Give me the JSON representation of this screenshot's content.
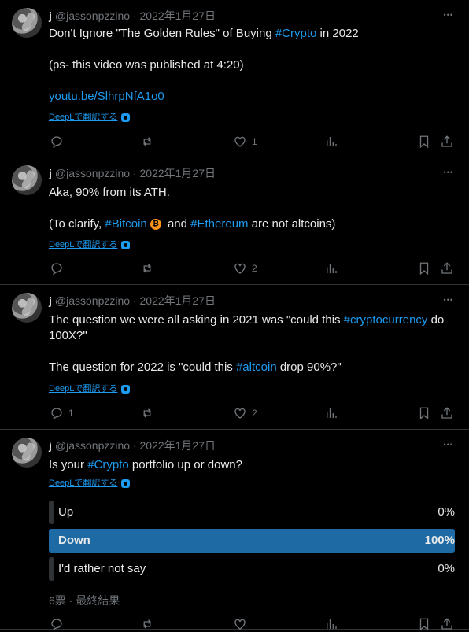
{
  "tweets": [
    {
      "name": "j",
      "handle": "@jassonpzzino",
      "date": "2022年1月27日",
      "lines": [
        [
          {
            "t": "Don't Ignore \"The Golden Rules\" of Buying "
          },
          {
            "t": "#Crypto",
            "tag": true
          },
          {
            "t": " in 2022"
          }
        ],
        [],
        [
          {
            "t": "(ps- this video was published at 4:20)"
          }
        ],
        [],
        [
          {
            "t": "youtu.be/SlhrpNfA1o0",
            "tag": true
          }
        ]
      ],
      "deepl": "DeepLで翻訳する",
      "reply": "",
      "retweet": "",
      "like": "1"
    },
    {
      "name": "j",
      "handle": "@jassonpzzino",
      "date": "2022年1月27日",
      "lines": [
        [
          {
            "t": "Aka, 90% from its ATH."
          }
        ],
        [],
        [
          {
            "t": "(To clarify, "
          },
          {
            "t": "#Bitcoin",
            "tag": true
          },
          {
            "t": "₿",
            "btc": true
          },
          {
            "t": "  and "
          },
          {
            "t": "#Ethereum",
            "tag": true
          },
          {
            "t": " are not altcoins)"
          }
        ]
      ],
      "deepl": "DeepLで翻訳する",
      "reply": "",
      "retweet": "",
      "like": "2"
    },
    {
      "name": "j",
      "handle": "@jassonpzzino",
      "date": "2022年1月27日",
      "lines": [
        [
          {
            "t": "The question we were all asking in 2021 was \"could this "
          },
          {
            "t": "#cryptocurrency",
            "tag": true
          },
          {
            "t": " do"
          }
        ],
        [
          {
            "t": "100X?\""
          }
        ],
        [],
        [
          {
            "t": "The question for 2022 is \"could this "
          },
          {
            "t": "#altcoin",
            "tag": true
          },
          {
            "t": " drop 90%?\""
          }
        ]
      ],
      "deepl": "DeepLで翻訳する",
      "reply": "1",
      "retweet": "",
      "like": "2"
    },
    {
      "name": "j",
      "handle": "@jassonpzzino",
      "date": "2022年1月27日",
      "lines": [
        [
          {
            "t": "Is your "
          },
          {
            "t": "#Crypto",
            "tag": true
          },
          {
            "t": " portfolio up or down?"
          }
        ]
      ],
      "deepl": "DeepLで翻訳する",
      "poll": {
        "options": [
          {
            "label": "Up",
            "pct": "0%",
            "fill": 0.02,
            "win": false
          },
          {
            "label": "Down",
            "pct": "100%",
            "fill": 1.0,
            "win": true
          },
          {
            "label": "I'd rather not say",
            "pct": "0%",
            "fill": 0.02,
            "win": false
          }
        ],
        "meta": "6票 · 最終結果"
      },
      "reply": "",
      "retweet": "",
      "like": ""
    }
  ],
  "colors": {
    "accent": "#1d9bf0",
    "poll_winner": "#1d6aa5",
    "border": "#2f3336",
    "muted": "#71767b"
  }
}
